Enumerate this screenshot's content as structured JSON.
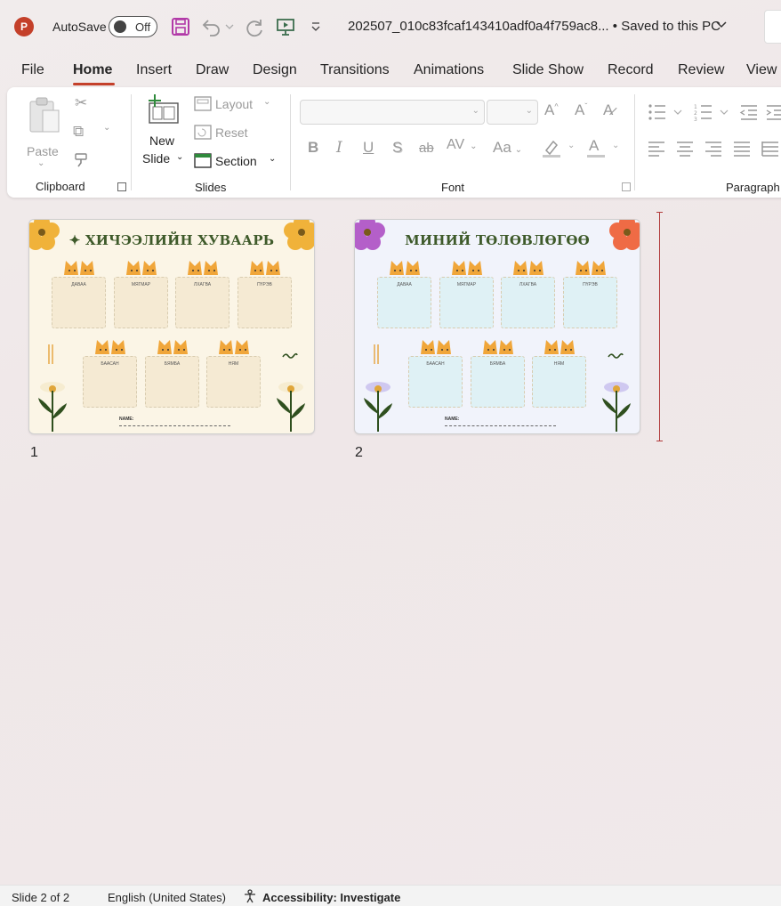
{
  "titlebar": {
    "app_letter": "P",
    "autosave_label": "AutoSave",
    "autosave_state": "Off",
    "document_title": "202507_010c83fcaf143410adf0a4f759ac8...",
    "save_status": "• Saved to this PC",
    "brand_color": "#c4402a"
  },
  "tabs": [
    "File",
    "Home",
    "Insert",
    "Draw",
    "Design",
    "Transitions",
    "Animations",
    "Slide Show",
    "Record",
    "Review",
    "View"
  ],
  "active_tab": "Home",
  "ribbon": {
    "clipboard": {
      "group_label": "Clipboard",
      "paste_label": "Paste"
    },
    "slides": {
      "group_label": "Slides",
      "new_slide_line1": "New",
      "new_slide_line2": "Slide",
      "layout_label": "Layout",
      "reset_label": "Reset",
      "section_label": "Section"
    },
    "font": {
      "group_label": "Font",
      "bold": "B",
      "italic": "I",
      "underline": "U",
      "shadow": "S",
      "strike": "ab",
      "spacing": "AV",
      "case": "Aa",
      "grow": "A",
      "shrink": "A"
    },
    "paragraph": {
      "group_label": "Paragraph"
    }
  },
  "slides": [
    {
      "number": "1",
      "title": "ХИЧЭЭЛИЙН ХУВААРЬ",
      "days_top": [
        "ДАВАА",
        "МЯГМАР",
        "ЛХАГВА",
        "ПҮРЭВ"
      ],
      "days_bottom": [
        "БААСАН",
        "БЯМБА",
        "НЯМ"
      ],
      "name_label": "NAME:",
      "bg_color": "#fbf5e6",
      "box_color": "#f5ead3",
      "flower_color": "#f0b23a"
    },
    {
      "number": "2",
      "title": "МИНИЙ ТӨЛӨВЛӨГӨӨ",
      "days_top": [
        "ДАВАА",
        "МЯГМАР",
        "ЛХАГВА",
        "ПҮРЭВ"
      ],
      "days_bottom": [
        "БААСАН",
        "БЯМБА",
        "НЯМ"
      ],
      "name_label": "NAME:",
      "bg_color": "#f1f3fb",
      "box_color": "#dff1f5",
      "flower_color": "#b45fc9",
      "flower_color_right": "#ef6b45"
    }
  ],
  "statusbar": {
    "slide_info": "Slide 2 of 2",
    "language": "English (United States)",
    "accessibility": "Accessibility: Investigate"
  }
}
